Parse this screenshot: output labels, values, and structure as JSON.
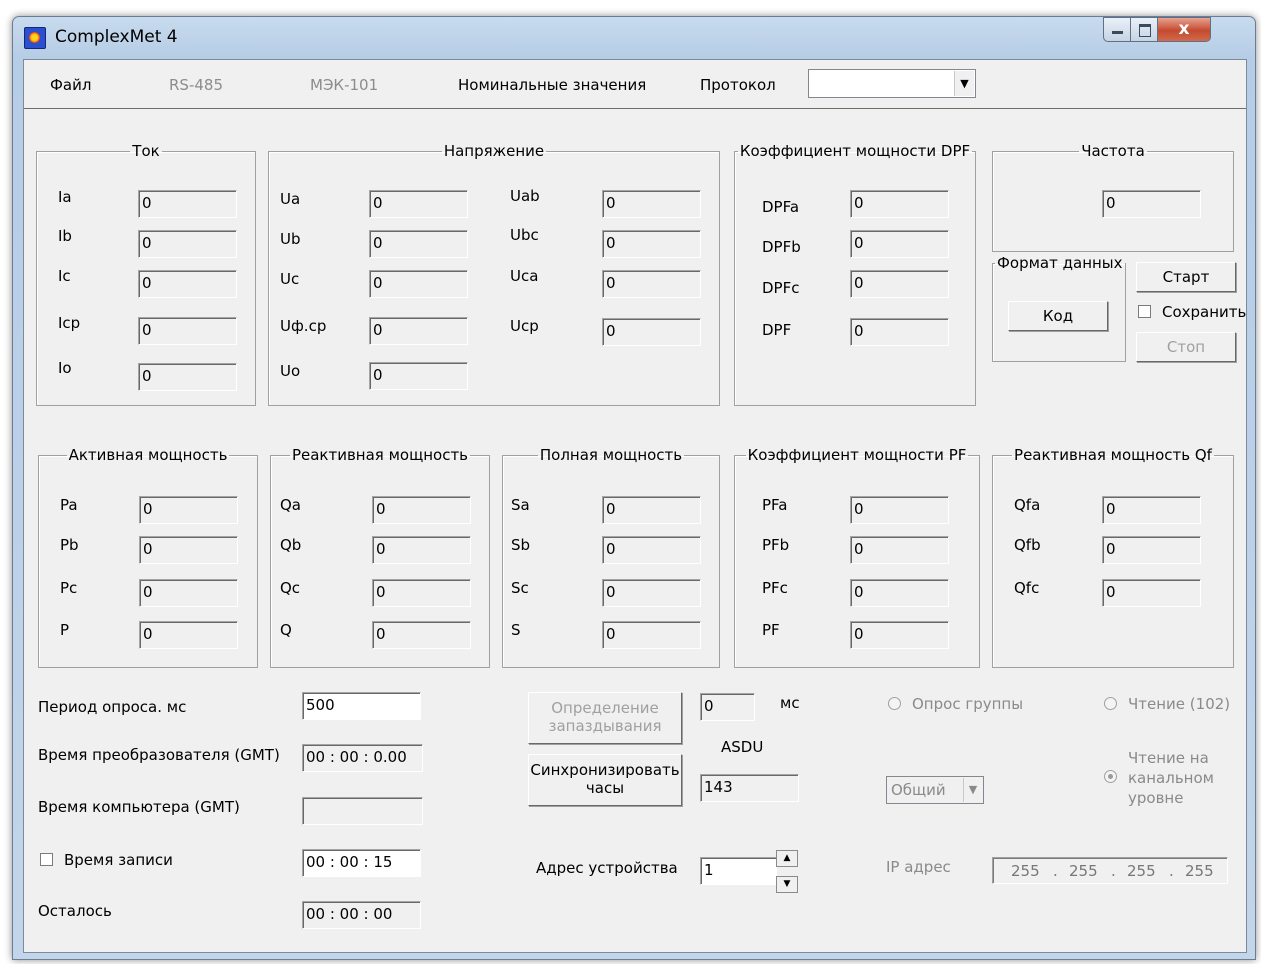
{
  "window": {
    "title": "ComplexMet 4",
    "close_glyph": "x",
    "icon": "app-logo-icon"
  },
  "menu": {
    "file": "Файл",
    "rs485": "RS-485",
    "mek101": "МЭК-101",
    "nominal": "Номинальные значения",
    "protocol_label": "Протокол",
    "protocol_value": ""
  },
  "current": {
    "title": "Ток",
    "rows": [
      {
        "label": "Ia",
        "value": "0"
      },
      {
        "label": "Ib",
        "value": "0"
      },
      {
        "label": "Ic",
        "value": "0"
      },
      {
        "label": "Icp",
        "value": "0"
      },
      {
        "label": "Io",
        "value": "0"
      }
    ]
  },
  "voltage": {
    "title": "Напряжение",
    "left": [
      {
        "label": "Ua",
        "value": "0"
      },
      {
        "label": "Ub",
        "value": "0"
      },
      {
        "label": "Uc",
        "value": "0"
      },
      {
        "label": "Uф.ср",
        "value": "0"
      },
      {
        "label": "Uo",
        "value": "0"
      }
    ],
    "right": [
      {
        "label": "Uab",
        "value": "0"
      },
      {
        "label": "Ubc",
        "value": "0"
      },
      {
        "label": "Uca",
        "value": "0"
      },
      {
        "label": "Ucp",
        "value": "0"
      }
    ]
  },
  "dpf": {
    "title": "Коэффициент мощности DPF",
    "rows": [
      {
        "label": "DPFa",
        "value": "0"
      },
      {
        "label": "DPFb",
        "value": "0"
      },
      {
        "label": "DPFc",
        "value": "0"
      },
      {
        "label": "DPF",
        "value": "0"
      }
    ]
  },
  "frequency": {
    "title": "Частота",
    "value": "0"
  },
  "format": {
    "title": "Формат данных",
    "button": "Код"
  },
  "controls": {
    "start": "Старт",
    "save": "Сохранить",
    "stop": "Стоп"
  },
  "active_power": {
    "title": "Активная мощность",
    "rows": [
      {
        "label": "Pa",
        "value": "0"
      },
      {
        "label": "Pb",
        "value": "0"
      },
      {
        "label": "Pc",
        "value": "0"
      },
      {
        "label": "P",
        "value": "0"
      }
    ]
  },
  "reactive_power": {
    "title": "Реактивная мощность",
    "rows": [
      {
        "label": "Qa",
        "value": "0"
      },
      {
        "label": "Qb",
        "value": "0"
      },
      {
        "label": "Qc",
        "value": "0"
      },
      {
        "label": "Q",
        "value": "0"
      }
    ]
  },
  "full_power": {
    "title": "Полная мощность",
    "rows": [
      {
        "label": "Sa",
        "value": "0"
      },
      {
        "label": "Sb",
        "value": "0"
      },
      {
        "label": "Sc",
        "value": "0"
      },
      {
        "label": "S",
        "value": "0"
      }
    ]
  },
  "pf": {
    "title": "Коэффициент мощности PF",
    "rows": [
      {
        "label": "PFa",
        "value": "0"
      },
      {
        "label": "PFb",
        "value": "0"
      },
      {
        "label": "PFc",
        "value": "0"
      },
      {
        "label": "PF",
        "value": "0"
      }
    ]
  },
  "qf": {
    "title": "Реактивная мощность Qf",
    "rows": [
      {
        "label": "Qfa",
        "value": "0"
      },
      {
        "label": "Qfb",
        "value": "0"
      },
      {
        "label": "Qfc",
        "value": "0"
      }
    ]
  },
  "bottom": {
    "poll_period_label": "Период опроса. мс",
    "poll_period_value": "500",
    "converter_time_label": "Время преобразователя (GMT)",
    "converter_time_value": "00 : 00 : 0.00",
    "computer_time_label": "Время компьютера (GMT)",
    "computer_time_value": "",
    "record_time_label": "Время записи",
    "record_time_value": "00 : 00 : 15",
    "remaining_label": "Осталось",
    "remaining_value": "00 : 00 : 00",
    "delay_button": "Определение запаздывания",
    "delay_value": "0",
    "delay_unit": "мс",
    "asdu_label": "ASDU",
    "sync_button": "Синхронизировать часы",
    "asdu_value": "143",
    "device_address_label": "Адрес устройства",
    "device_address_value": "1",
    "group_poll": "Опрос группы",
    "read_102": "Чтение (102)",
    "channel_read": "Чтение на канальном уровне",
    "general_select": "Общий",
    "ip_label": "IP адрес",
    "ip": [
      "255",
      "255",
      "255",
      "255"
    ]
  }
}
